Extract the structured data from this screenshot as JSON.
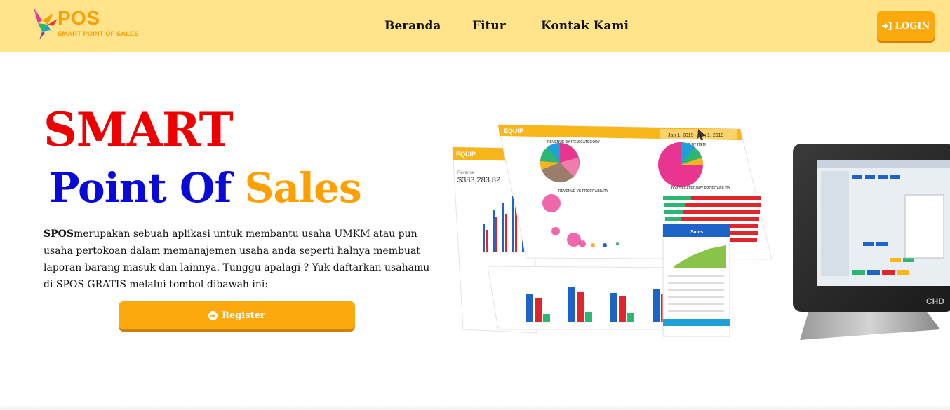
{
  "brand": {
    "name": "POS",
    "tagline": "SMART POINT OF SALES",
    "colors": {
      "accent": "#fca90e",
      "navbar": "#ffe48c",
      "red": "#ee0000",
      "blue": "#0a0ad8",
      "orange": "#ffa000"
    }
  },
  "nav": {
    "items": [
      {
        "label": "Beranda"
      },
      {
        "label": "Fitur"
      },
      {
        "label": "Kontak Kami"
      }
    ],
    "login_label": "LOGIN",
    "login_icon": "sign-in-icon"
  },
  "hero": {
    "title_line1": "SMART",
    "title_line2_a": "Point Of",
    "title_line2_b": "Sales",
    "desc_strong": "SPOS",
    "desc_text": "merupakan sebuah aplikasi untuk membantu usaha UMKM atau pun usaha pertokoan dalam memanajemen usaha anda seperti halnya membuat laporan barang masuk dan lainnya. Tunggu apalagi ? Yuk daftarkan usahamu di SPOS GRATIS melalui tombol dibawah ini:",
    "register_label": "Register",
    "register_icon": "arrow-circle-right-icon"
  },
  "illustration": {
    "brand": "EQUIP",
    "revenue_label": "Revenue",
    "revenue_value": "$383,283.82",
    "date_range": "Jan 1, 2019 - Jun 1, 2019",
    "panel_titles": [
      "REVENUE BY ITEM CATEGORY",
      "REVENUE BY ITEM",
      "REVENUE VS PROFITABILITY",
      "TOP 10 CATEGORY PROFITABILITY"
    ],
    "phone_title": "Sales",
    "terminal_logo": "CHD"
  }
}
